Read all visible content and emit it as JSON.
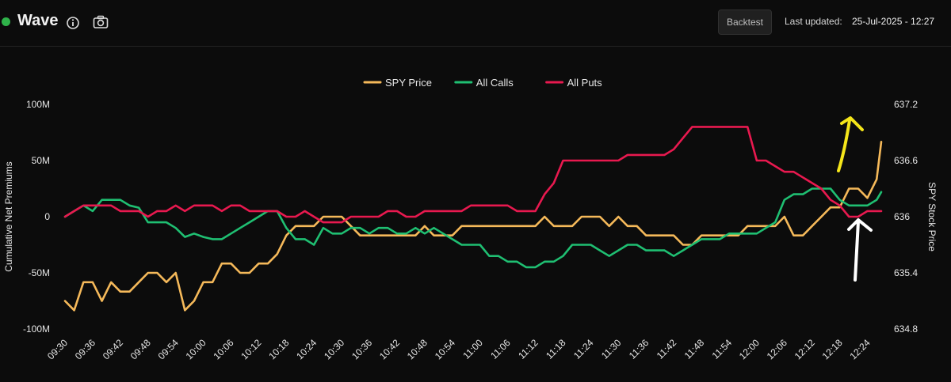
{
  "header": {
    "title": "Wave",
    "status_color": "#2fb34a",
    "info_icon": "info-circle-icon",
    "camera_icon": "camera-icon",
    "backtest_label": "Backtest",
    "updated_label": "Last updated:",
    "updated_value": "25-Jul-2025 - 12:27"
  },
  "chart_data": {
    "type": "line",
    "title": "",
    "ylabel": "Cumulative Net Premiums",
    "y2label": "SPY Stock Price",
    "ylim": [
      -100,
      100
    ],
    "y2lim": [
      634.8,
      637.2
    ],
    "yticks": [
      "100M",
      "50M",
      "0",
      "-50M",
      "-100M"
    ],
    "y2ticks": [
      "637.2",
      "636.6",
      "636",
      "635.4",
      "634.8"
    ],
    "x_ticks": [
      "09:30",
      "09:36",
      "09:42",
      "09:48",
      "09:54",
      "10:00",
      "10:06",
      "10:12",
      "10:18",
      "10:24",
      "10:30",
      "10:36",
      "10:42",
      "10:48",
      "10:54",
      "11:00",
      "11:06",
      "11:12",
      "11:18",
      "11:24",
      "11:30",
      "11:36",
      "11:42",
      "11:48",
      "11:54",
      "12:00",
      "12:06",
      "12:12",
      "12:18",
      "12:24"
    ],
    "x_range_minutes": [
      0,
      177
    ],
    "legend_position": "top-center",
    "grid": false,
    "series": [
      {
        "name": "SPY Price",
        "axis": "right",
        "color": "#f5b95a",
        "x": [
          0,
          2,
          4,
          6,
          8,
          10,
          12,
          14,
          16,
          18,
          20,
          22,
          24,
          26,
          28,
          30,
          32,
          34,
          36,
          38,
          40,
          42,
          44,
          46,
          48,
          50,
          52,
          54,
          56,
          58,
          60,
          62,
          64,
          66,
          68,
          70,
          72,
          74,
          76,
          78,
          80,
          82,
          84,
          86,
          88,
          90,
          92,
          94,
          96,
          98,
          100,
          102,
          104,
          106,
          108,
          110,
          112,
          114,
          116,
          118,
          120,
          122,
          124,
          126,
          128,
          130,
          132,
          134,
          136,
          138,
          140,
          142,
          144,
          146,
          148,
          150,
          152,
          154,
          156,
          158,
          160,
          162,
          164,
          166,
          168,
          170,
          172,
          174,
          176,
          177
        ],
        "values": [
          635.1,
          635.0,
          635.3,
          635.3,
          635.1,
          635.3,
          635.2,
          635.2,
          635.3,
          635.4,
          635.4,
          635.3,
          635.4,
          635.0,
          635.1,
          635.3,
          635.3,
          635.5,
          635.5,
          635.4,
          635.4,
          635.5,
          635.5,
          635.6,
          635.8,
          635.9,
          635.9,
          635.9,
          636.0,
          636.0,
          636.0,
          635.9,
          635.8,
          635.8,
          635.8,
          635.8,
          635.8,
          635.8,
          635.8,
          635.9,
          635.8,
          635.8,
          635.8,
          635.9,
          635.9,
          635.9,
          635.9,
          635.9,
          635.9,
          635.9,
          635.9,
          635.9,
          636.0,
          635.9,
          635.9,
          635.9,
          636.0,
          636.0,
          636.0,
          635.9,
          636.0,
          635.9,
          635.9,
          635.8,
          635.8,
          635.8,
          635.8,
          635.7,
          635.7,
          635.8,
          635.8,
          635.8,
          635.8,
          635.8,
          635.9,
          635.9,
          635.9,
          635.9,
          636.0,
          635.8,
          635.8,
          635.9,
          636.0,
          636.1,
          636.1,
          636.3,
          636.3,
          636.2,
          636.4,
          636.8
        ]
      },
      {
        "name": "All Calls",
        "axis": "left",
        "color": "#1fbf72",
        "x": [
          0,
          2,
          4,
          6,
          8,
          10,
          12,
          14,
          16,
          18,
          20,
          22,
          24,
          26,
          28,
          30,
          32,
          34,
          36,
          38,
          40,
          42,
          44,
          46,
          48,
          50,
          52,
          54,
          56,
          58,
          60,
          62,
          64,
          66,
          68,
          70,
          72,
          74,
          76,
          78,
          80,
          82,
          84,
          86,
          88,
          90,
          92,
          94,
          96,
          98,
          100,
          102,
          104,
          106,
          108,
          110,
          112,
          114,
          116,
          118,
          120,
          122,
          124,
          126,
          128,
          130,
          132,
          134,
          136,
          138,
          140,
          142,
          144,
          146,
          148,
          150,
          152,
          154,
          156,
          158,
          160,
          162,
          164,
          166,
          168,
          170,
          172,
          174,
          176,
          177
        ],
        "values": [
          0,
          5,
          10,
          5,
          15,
          15,
          15,
          10,
          8,
          -5,
          -5,
          -5,
          -10,
          -18,
          -15,
          -18,
          -20,
          -20,
          -15,
          -10,
          -5,
          0,
          5,
          5,
          -10,
          -20,
          -20,
          -25,
          -10,
          -15,
          -15,
          -10,
          -10,
          -15,
          -10,
          -10,
          -15,
          -15,
          -10,
          -15,
          -10,
          -15,
          -20,
          -25,
          -25,
          -25,
          -35,
          -35,
          -40,
          -40,
          -45,
          -45,
          -40,
          -40,
          -35,
          -25,
          -25,
          -25,
          -30,
          -35,
          -30,
          -25,
          -25,
          -30,
          -30,
          -30,
          -35,
          -30,
          -25,
          -20,
          -20,
          -20,
          -15,
          -15,
          -15,
          -15,
          -10,
          -5,
          15,
          20,
          20,
          25,
          25,
          25,
          15,
          10,
          10,
          10,
          15,
          22
        ]
      },
      {
        "name": "All Puts",
        "axis": "left",
        "color": "#e8194f",
        "x": [
          0,
          2,
          4,
          6,
          8,
          10,
          12,
          14,
          16,
          18,
          20,
          22,
          24,
          26,
          28,
          30,
          32,
          34,
          36,
          38,
          40,
          42,
          44,
          46,
          48,
          50,
          52,
          54,
          56,
          58,
          60,
          62,
          64,
          66,
          68,
          70,
          72,
          74,
          76,
          78,
          80,
          82,
          84,
          86,
          88,
          90,
          92,
          94,
          96,
          98,
          100,
          102,
          104,
          106,
          108,
          110,
          112,
          114,
          116,
          118,
          120,
          122,
          124,
          126,
          128,
          130,
          132,
          134,
          136,
          138,
          140,
          142,
          144,
          146,
          148,
          150,
          152,
          154,
          156,
          158,
          160,
          162,
          164,
          166,
          168,
          170,
          172,
          174,
          176,
          177
        ],
        "values": [
          0,
          5,
          10,
          10,
          10,
          10,
          5,
          5,
          5,
          0,
          5,
          5,
          10,
          5,
          10,
          10,
          10,
          5,
          10,
          10,
          5,
          5,
          5,
          5,
          0,
          0,
          5,
          0,
          -5,
          -5,
          -5,
          0,
          0,
          0,
          0,
          5,
          5,
          0,
          0,
          5,
          5,
          5,
          5,
          5,
          10,
          10,
          10,
          10,
          10,
          5,
          5,
          5,
          20,
          30,
          50,
          50,
          50,
          50,
          50,
          50,
          50,
          55,
          55,
          55,
          55,
          55,
          60,
          70,
          80,
          80,
          80,
          80,
          80,
          80,
          80,
          50,
          50,
          45,
          40,
          40,
          35,
          30,
          25,
          15,
          10,
          0,
          0,
          5,
          5,
          5
        ]
      }
    ]
  },
  "annotations": [
    {
      "name": "yellow-up-arrow",
      "color": "#f5e61a"
    },
    {
      "name": "white-up-arrow",
      "color": "#ffffff"
    }
  ]
}
